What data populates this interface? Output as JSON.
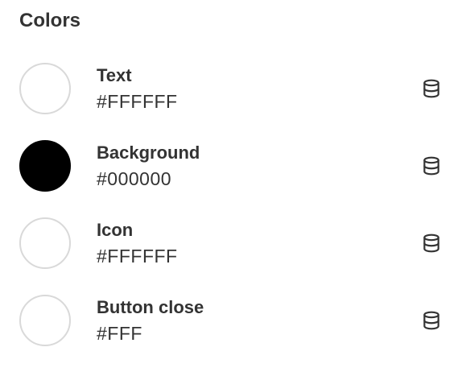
{
  "section": {
    "title": "Colors"
  },
  "colors": [
    {
      "label": "Text",
      "value": "#FFFFFF",
      "swatch": "#FFFFFF",
      "icon": "database-icon"
    },
    {
      "label": "Background",
      "value": "#000000",
      "swatch": "#000000",
      "icon": "database-icon"
    },
    {
      "label": "Icon",
      "value": "#FFFFFF",
      "swatch": "#FFFFFF",
      "icon": "database-icon"
    },
    {
      "label": "Button close",
      "value": "#FFF",
      "swatch": "#FFFFFF",
      "icon": "database-icon"
    }
  ],
  "theme": {
    "text_color": "#333333",
    "swatch_border": "#D9D9D9"
  }
}
